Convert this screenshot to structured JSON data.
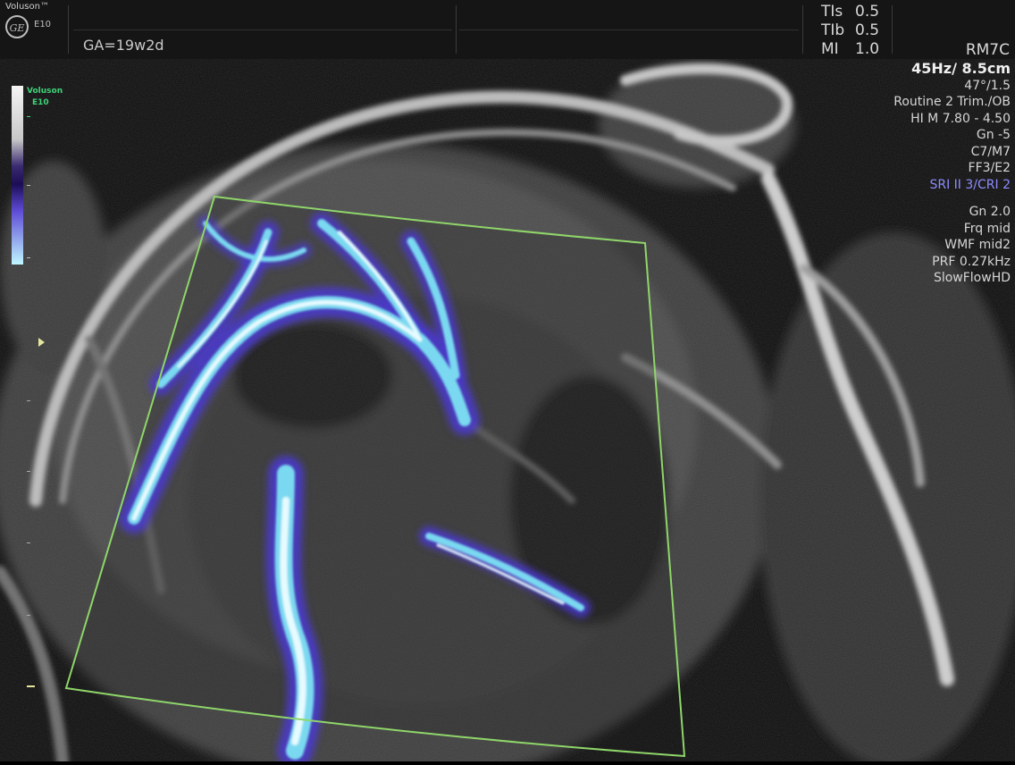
{
  "header": {
    "brand": "Voluson™",
    "logo": "GE",
    "model": "E10",
    "gestational_age": "GA=19w2d",
    "indices": [
      {
        "label": "TIs",
        "value": "0.5"
      },
      {
        "label": "TIb",
        "value": "0.5"
      },
      {
        "label": "MI",
        "value": "1.0"
      }
    ],
    "probe": "RM7C"
  },
  "params": {
    "frame_rate_depth": "45Hz/ 8.5cm",
    "angle": "47°/1.5",
    "preset": "Routine 2 Trim./OB",
    "harmonic": "HI M  7.80 - 4.50",
    "gain": "Gn  -5",
    "map": "C7/M7",
    "ff": "FF3/E2",
    "sri_cri": "SRI II 3/CRI 2",
    "color_gain": "Gn  2.0",
    "frequency": "Frq mid",
    "wall_filter": "WMF mid2",
    "prf": "PRF 0.27kHz",
    "mode": "SlowFlowHD"
  },
  "color_scale": {
    "brand": "Voluson",
    "model": "E10",
    "colors": {
      "high": "#bff7ff",
      "mid": "#5e4bd6",
      "low": "#1c0d55"
    }
  },
  "colors": {
    "roi_border": "#8fd66a",
    "flow_light": "#c8f6ff",
    "flow_mid": "#7ad9f0",
    "flow_deep": "#4a3ad0"
  }
}
